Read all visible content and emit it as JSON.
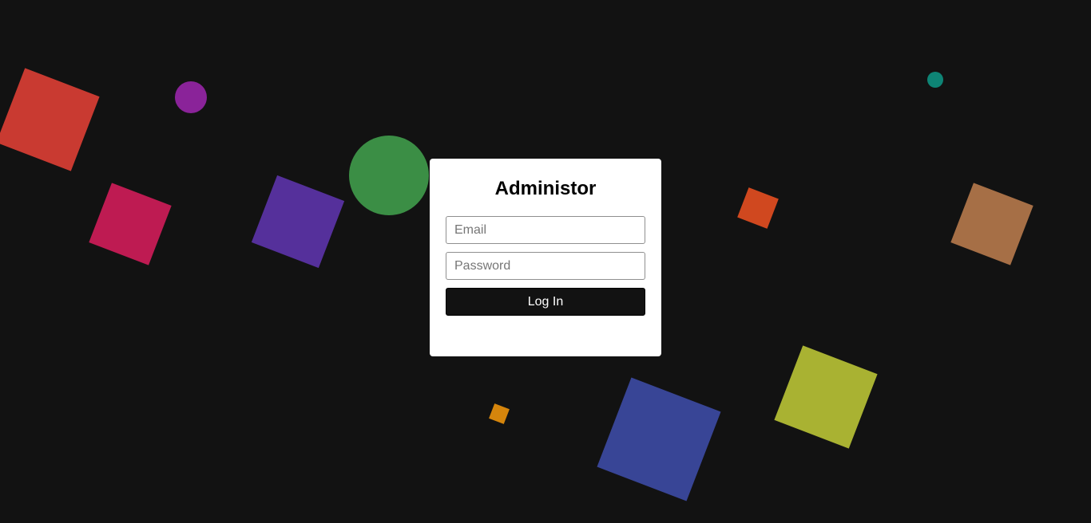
{
  "login": {
    "title": "Administor",
    "email_placeholder": "Email",
    "password_placeholder": "Password",
    "submit_label": "Log In"
  },
  "colors": {
    "background": "#121212",
    "card": "#ffffff",
    "button": "#121212",
    "shapes": [
      "#c93a31",
      "#8a2399",
      "#3b8e45",
      "#0e8475",
      "#be1b52",
      "#55309b",
      "#d0481f",
      "#a66f46",
      "#a9b232",
      "#384596",
      "#d5850c"
    ]
  }
}
